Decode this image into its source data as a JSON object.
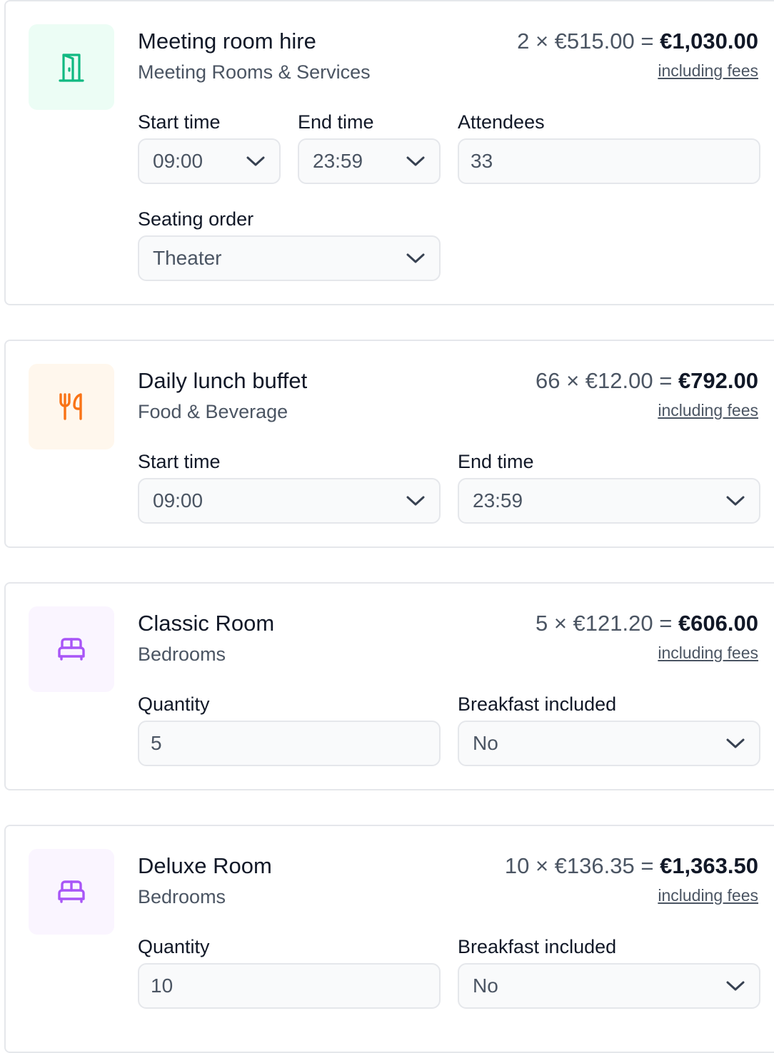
{
  "cards": [
    {
      "title": "Meeting room hire",
      "category": "Meeting Rooms & Services",
      "icon": "door-icon",
      "qty_price": "2 × €515.00 = ",
      "total": "€1,030.00",
      "fees_label": "including fees",
      "fields": {
        "start_time": {
          "label": "Start time",
          "value": "09:00"
        },
        "end_time": {
          "label": "End time",
          "value": "23:59"
        },
        "attendees": {
          "label": "Attendees",
          "value": "33"
        },
        "seating": {
          "label": "Seating order",
          "value": "Theater"
        }
      }
    },
    {
      "title": "Daily lunch buffet",
      "category": "Food & Beverage",
      "icon": "utensils-icon",
      "qty_price": "66 × €12.00 = ",
      "total": "€792.00",
      "fees_label": "including fees",
      "fields": {
        "start_time": {
          "label": "Start time",
          "value": "09:00"
        },
        "end_time": {
          "label": "End time",
          "value": "23:59"
        }
      }
    },
    {
      "title": "Classic Room",
      "category": "Bedrooms",
      "icon": "bed-icon",
      "qty_price": "5 × €121.20 = ",
      "total": "€606.00",
      "fees_label": "including fees",
      "fields": {
        "quantity": {
          "label": "Quantity",
          "value": "5"
        },
        "breakfast": {
          "label": "Breakfast included",
          "value": "No"
        }
      }
    },
    {
      "title": "Deluxe Room",
      "category": "Bedrooms",
      "icon": "bed-icon",
      "qty_price": "10 × €136.35 = ",
      "total": "€1,363.50",
      "fees_label": "including fees",
      "fields": {
        "quantity": {
          "label": "Quantity",
          "value": "10"
        },
        "breakfast": {
          "label": "Breakfast included",
          "value": "No"
        }
      }
    }
  ],
  "colors": {
    "meeting_accent": "#10b981",
    "food_accent": "#f97316",
    "bedroom_accent": "#a855f7"
  }
}
